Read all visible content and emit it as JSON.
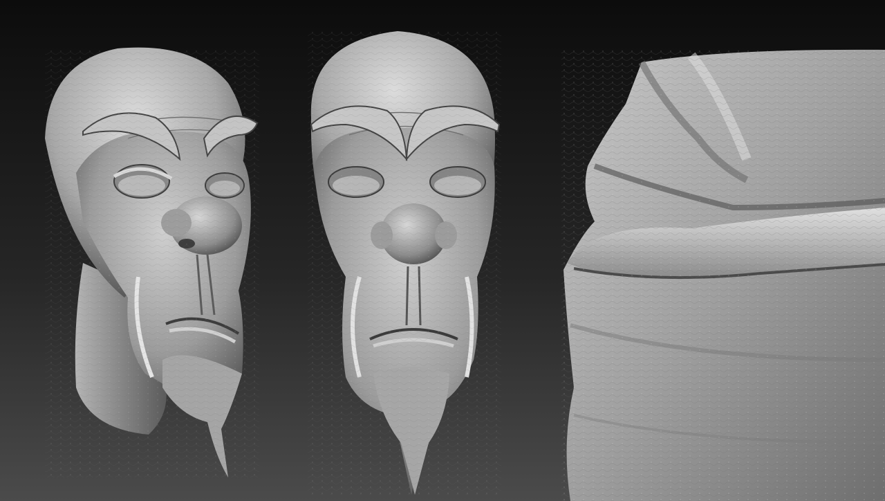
{
  "scene": {
    "background_top": "#0d0d0d",
    "background_bottom": "#4a4a4a",
    "clay_light": "#d8d8d8",
    "clay_mid": "#9a9a9a",
    "clay_dark": "#3a3a3a"
  },
  "renders": [
    {
      "name": "three-quarter-head-view"
    },
    {
      "name": "front-head-view"
    },
    {
      "name": "closeup-nose-mouth-view"
    }
  ]
}
